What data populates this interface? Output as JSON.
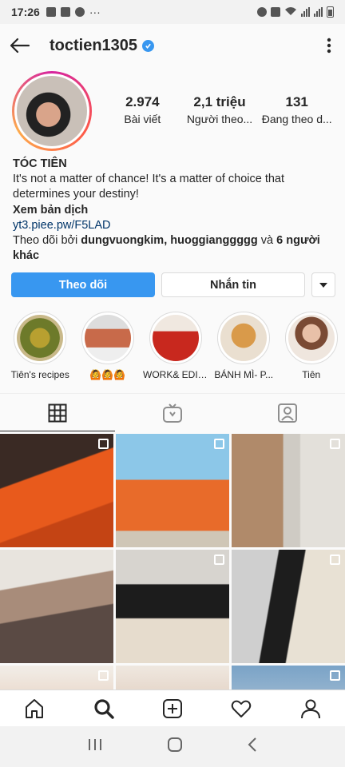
{
  "status_bar": {
    "time": "17:26",
    "dots": "···"
  },
  "header": {
    "username": "toctien1305"
  },
  "stats": [
    {
      "num": "2.974",
      "label": "Bài viết"
    },
    {
      "num": "2,1 triệu",
      "label": "Người theo..."
    },
    {
      "num": "131",
      "label": "Đang theo d..."
    }
  ],
  "bio": {
    "name": "TÓC TIÊN",
    "text": "It's not a matter of chance! It's a matter of choice that determines your destiny!",
    "translate": "Xem bản dịch",
    "link": "yt3.piee.pw/F5LAD",
    "followed_prefix": "Theo dõi bởi ",
    "followed_users": "dungvuongkim, huoggianggggg",
    "followed_and": " và ",
    "followed_others": "6 người khác"
  },
  "buttons": {
    "follow": "Theo dõi",
    "message": "Nhắn tin"
  },
  "highlights": [
    {
      "label": "Tiên's recipes"
    },
    {
      "label": "🙆🙆🙆"
    },
    {
      "label": "WORK& EDIT..."
    },
    {
      "label": "BÁNH MÌ- P..."
    },
    {
      "label": "Tiên"
    }
  ],
  "colors": {
    "accent": "#3897f0",
    "text": "#262626",
    "link": "#003569"
  }
}
